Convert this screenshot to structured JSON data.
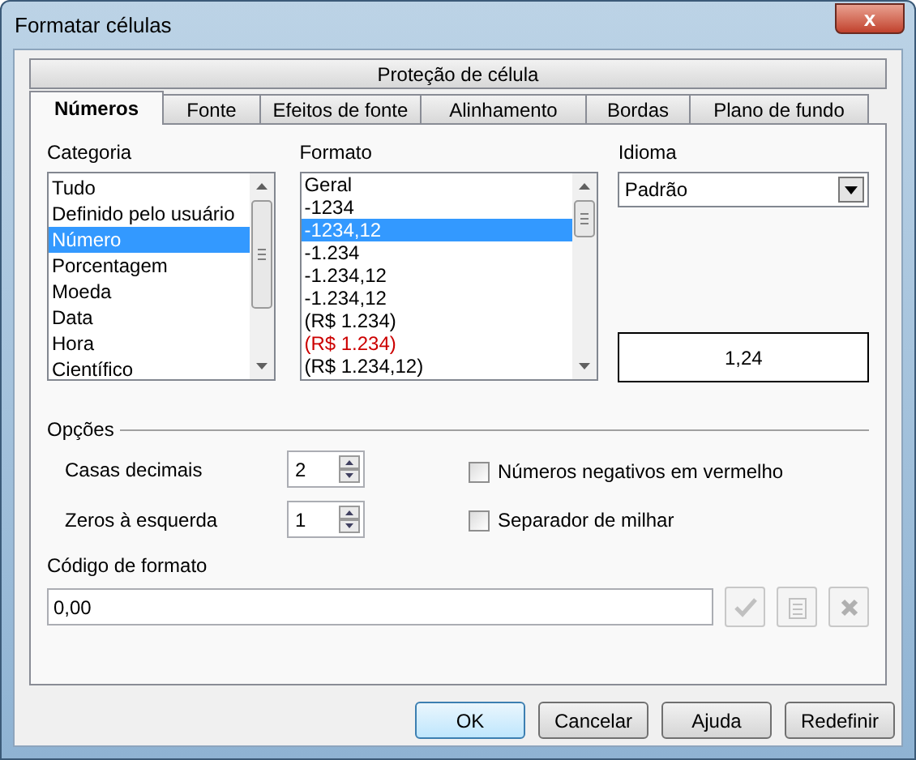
{
  "window": {
    "title": "Formatar células",
    "close_label": "x"
  },
  "tabs_back": [
    {
      "label": "Proteção de célula",
      "selected": false
    }
  ],
  "tabs": [
    {
      "label": "Números",
      "selected": true
    },
    {
      "label": "Fonte",
      "selected": false
    },
    {
      "label": "Efeitos de fonte",
      "selected": false
    },
    {
      "label": "Alinhamento",
      "selected": false
    },
    {
      "label": "Bordas",
      "selected": false
    },
    {
      "label": "Plano de fundo",
      "selected": false
    }
  ],
  "category": {
    "label": "Categoria",
    "items": [
      {
        "label": "Tudo",
        "selected": false
      },
      {
        "label": "Definido pelo usuário",
        "selected": false
      },
      {
        "label": "Número",
        "selected": true
      },
      {
        "label": "Porcentagem",
        "selected": false
      },
      {
        "label": "Moeda",
        "selected": false
      },
      {
        "label": "Data",
        "selected": false
      },
      {
        "label": "Hora",
        "selected": false
      },
      {
        "label": "Científico",
        "selected": false
      }
    ]
  },
  "format": {
    "label": "Formato",
    "items": [
      {
        "label": "Geral",
        "selected": false,
        "color": "#000000"
      },
      {
        "label": "-1234",
        "selected": false,
        "color": "#000000"
      },
      {
        "label": "-1234,12",
        "selected": true
      },
      {
        "label": "-1.234",
        "selected": false,
        "color": "#000000"
      },
      {
        "label": "-1.234,12",
        "selected": false,
        "color": "#000000"
      },
      {
        "label": "-1.234,12",
        "selected": false,
        "color": "#000000"
      },
      {
        "label": "(R$ 1.234)",
        "selected": false,
        "color": "#000000"
      },
      {
        "label": "(R$ 1.234)",
        "selected": false,
        "color": "#cc0000"
      },
      {
        "label": "(R$ 1.234,12)",
        "selected": false,
        "color": "#000000"
      }
    ]
  },
  "language": {
    "label": "Idioma",
    "value": "Padrão"
  },
  "preview": "1,24",
  "options": {
    "title": "Opções",
    "spins": [
      {
        "label": "Casas decimais",
        "value": "2"
      },
      {
        "label": "Zeros à esquerda",
        "value": "1"
      }
    ],
    "checkboxes": [
      {
        "label": "Números negativos em vermelho",
        "checked": false
      },
      {
        "label": "Separador de milhar",
        "checked": false
      }
    ]
  },
  "format_code": {
    "label": "Código de formato",
    "value": "0,00"
  },
  "buttons": [
    {
      "label": "OK",
      "default": true
    },
    {
      "label": "Cancelar",
      "default": false
    },
    {
      "label": "Ajuda",
      "default": false
    },
    {
      "label": "Redefinir",
      "default": false
    }
  ]
}
